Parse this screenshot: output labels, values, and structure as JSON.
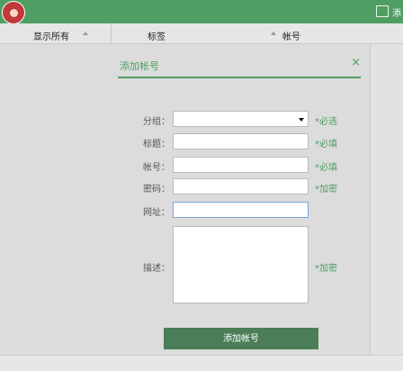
{
  "header": {
    "user_text": "添"
  },
  "columns": {
    "show_all": "显示所有",
    "tags": "标签",
    "account": "帐号"
  },
  "modal": {
    "title": "添加帐号",
    "close_icon": "×",
    "fields": {
      "group": {
        "label": "分组：",
        "value": "",
        "hint": "*必选"
      },
      "title": {
        "label": "标题：",
        "value": "",
        "hint": "*必填"
      },
      "account": {
        "label": "帐号：",
        "value": "",
        "hint": "*必填"
      },
      "password": {
        "label": "密码：",
        "value": "",
        "hint": "*加密"
      },
      "url": {
        "label": "网址：",
        "value": ""
      },
      "description": {
        "label": "描述：",
        "value": "",
        "hint": "*加密"
      }
    },
    "submit_label": "添加帐号"
  },
  "colors": {
    "accent": "#4f9e63",
    "button": "#4a7d58",
    "logo": "#c1393a"
  }
}
